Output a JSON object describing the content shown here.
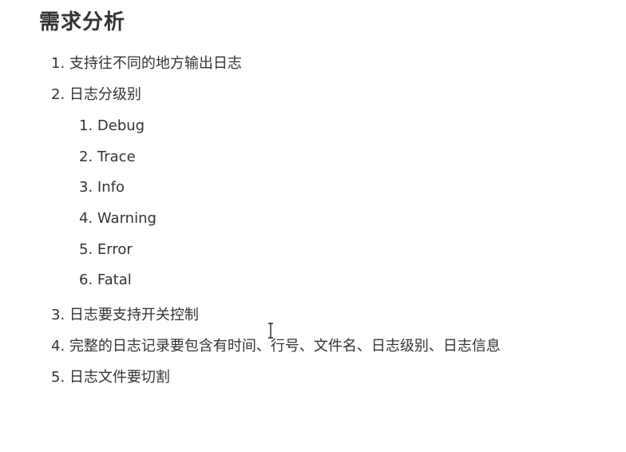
{
  "document": {
    "title": "需求分析",
    "items": [
      {
        "num": "1",
        "text": "支持往不同的地方输出日志"
      },
      {
        "num": "2",
        "text": "日志分级别",
        "subitems": [
          {
            "num": "1",
            "text": "Debug"
          },
          {
            "num": "2",
            "text": "Trace"
          },
          {
            "num": "3",
            "text": "Info"
          },
          {
            "num": "4",
            "text": "Warning"
          },
          {
            "num": "5",
            "text": "Error"
          },
          {
            "num": "6",
            "text": "Fatal"
          }
        ]
      },
      {
        "num": "3",
        "text": "日志要支持开关控制"
      },
      {
        "num": "4",
        "text": "完整的日志记录要包含有时间、行号、文件名、日志级别、日志信息"
      },
      {
        "num": "5",
        "text": "日志文件要切割"
      }
    ]
  },
  "cursor": {
    "icon": "text-cursor-icon"
  }
}
